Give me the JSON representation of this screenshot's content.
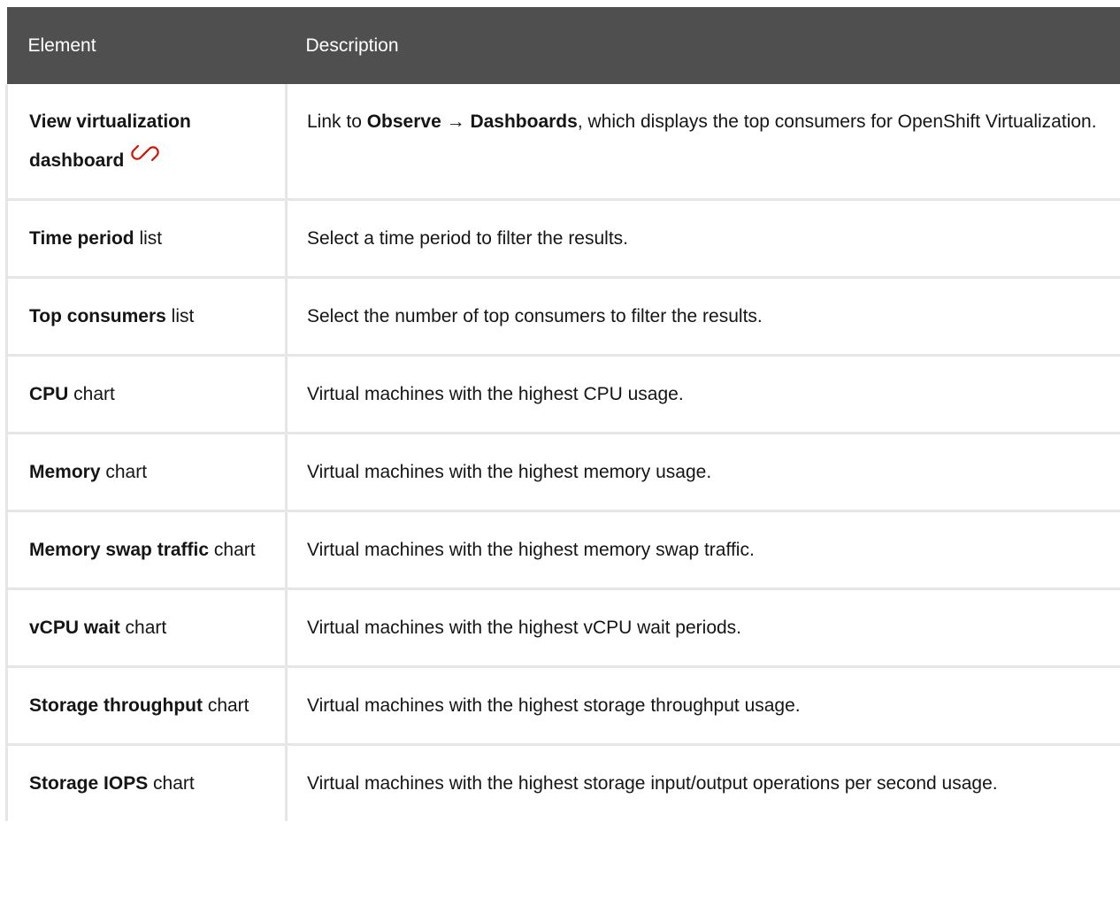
{
  "header": {
    "element": "Element",
    "description": "Description"
  },
  "rows": [
    {
      "element": {
        "strong": "View virtualization dashboard",
        "tail": ""
      },
      "description": {
        "before": "Link to ",
        "strong": "Observe → Dashboards",
        "after": ", which displays the top consumers for OpenShift Virtualization."
      }
    },
    {
      "element": {
        "strong": "Time period",
        "tail": " list"
      },
      "description": {
        "before": "Select a time period to filter the results.",
        "strong": "",
        "after": ""
      }
    },
    {
      "element": {
        "strong": "Top consumers",
        "tail": " list"
      },
      "description": {
        "before": "Select the number of top consumers to filter the results.",
        "strong": "",
        "after": ""
      }
    },
    {
      "element": {
        "strong": "CPU",
        "tail": " chart"
      },
      "description": {
        "before": "Virtual machines with the highest CPU usage.",
        "strong": "",
        "after": ""
      }
    },
    {
      "element": {
        "strong": "Memory",
        "tail": " chart"
      },
      "description": {
        "before": "Virtual machines with the highest memory usage.",
        "strong": "",
        "after": ""
      }
    },
    {
      "element": {
        "strong": "Memory swap traffic",
        "tail": " chart"
      },
      "description": {
        "before": "Virtual machines with the highest memory swap traffic.",
        "strong": "",
        "after": ""
      }
    },
    {
      "element": {
        "strong": "vCPU wait",
        "tail": " chart"
      },
      "description": {
        "before": "Virtual machines with the highest vCPU wait periods.",
        "strong": "",
        "after": ""
      }
    },
    {
      "element": {
        "strong": "Storage throughput",
        "tail": " chart"
      },
      "description": {
        "before": "Virtual machines with the highest storage throughput usage.",
        "strong": "",
        "after": ""
      }
    },
    {
      "element": {
        "strong": "Storage IOPS",
        "tail": " chart"
      },
      "description": {
        "before": "Virtual machines with the highest storage input/output operations per second usage.",
        "strong": "",
        "after": ""
      }
    }
  ],
  "icons": {
    "external_link": "link-icon",
    "link_color": "#c9190b"
  },
  "colors": {
    "header_bg": "#4f4f4f",
    "header_text": "#ffffff",
    "border": "#e6e6e6",
    "text": "#151515"
  }
}
